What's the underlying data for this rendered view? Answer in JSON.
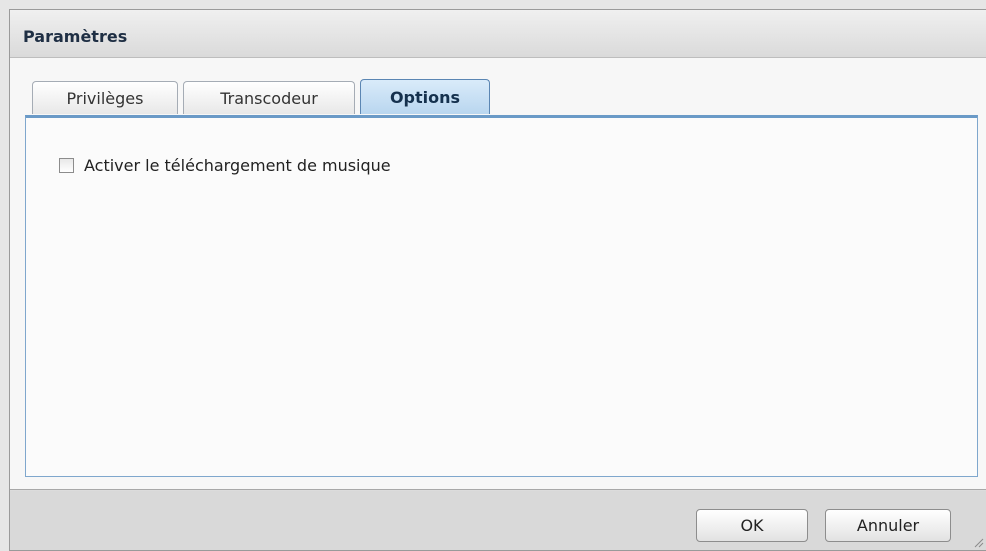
{
  "dialog": {
    "title": "Paramètres"
  },
  "tabs": [
    {
      "label": "Privilèges",
      "active": false
    },
    {
      "label": "Transcodeur",
      "active": false
    },
    {
      "label": "Options",
      "active": true
    }
  ],
  "options": {
    "music_download": {
      "label": "Activer le téléchargement de musique",
      "checked": false
    }
  },
  "buttons": {
    "ok_label": "OK",
    "cancel_label": "Annuler"
  },
  "icons": {
    "checkbox": "unchecked-checkbox-icon",
    "resize": "resize-grip-icon"
  },
  "colors": {
    "title_text": "#1f2f44",
    "active_tab": "#b9d6ef",
    "panel_border": "#7fa7cd"
  }
}
